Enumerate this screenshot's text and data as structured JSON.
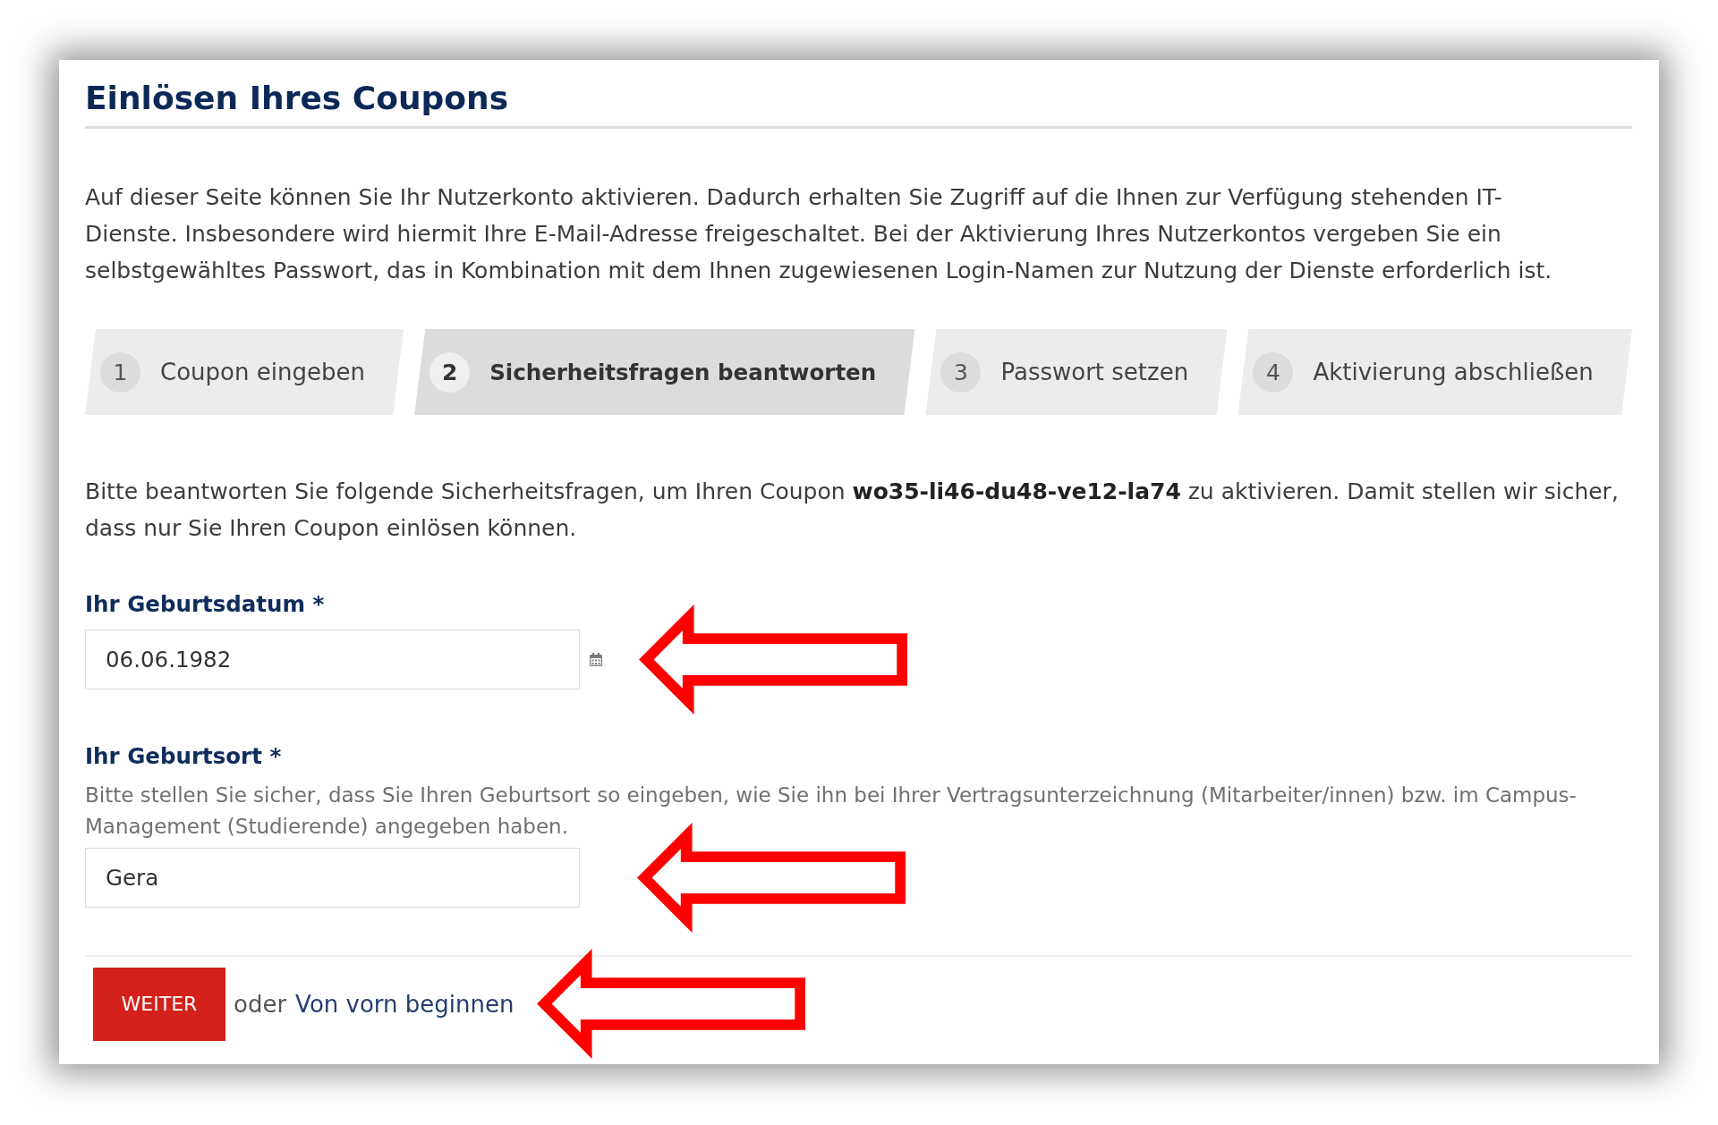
{
  "page": {
    "title": "Einlösen Ihres Coupons",
    "intro": "Auf dieser Seite können Sie Ihr Nutzerkonto aktivieren. Dadurch erhalten Sie Zugriff auf die Ihnen zur Verfügung stehenden IT-Dienste. Insbesondere wird hiermit Ihre E-Mail-Adresse freigeschaltet. Bei der Aktivierung Ihres Nutzerkontos vergeben Sie ein selbstgewähltes Passwort, das in Kombination mit dem Ihnen zugewiesenen Login-Namen zur Nutzung der Dienste erforderlich ist."
  },
  "steps": [
    {
      "number": "1",
      "label": "Coupon eingeben",
      "selected": false
    },
    {
      "number": "2",
      "label": "Sicherheitsfragen beantworten",
      "selected": true
    },
    {
      "number": "3",
      "label": "Passwort setzen",
      "selected": false
    },
    {
      "number": "4",
      "label": "Aktivierung abschließen",
      "selected": false
    }
  ],
  "instruction": "Bitte beantworten Sie folgende Sicherheitsfragen, um Ihren Coupon **wo35-li46-du48-ve12-la74** zu aktivieren. Damit stellen wir sicher, dass nur Sie Ihren Coupon einlösen können.",
  "fields": [
    {
      "kind": "date",
      "label": "Ihr Geburtsdatum *",
      "value": "06.06.1982"
    },
    {
      "kind": "text",
      "label": "Ihr Geburtsort *",
      "hint": "Bitte stellen Sie sicher, dass Sie Ihren Geburtsort so eingeben, wie Sie ihn bei Ihrer Vertragsunterzeichnung (Mitarbeiter/innen) bzw. im Campus-Management (Studierende) angegeben haben.",
      "value": "Gera"
    }
  ],
  "actions": {
    "button": "WEITER",
    "separator": "oder",
    "link": "Von vorn beginnen"
  }
}
